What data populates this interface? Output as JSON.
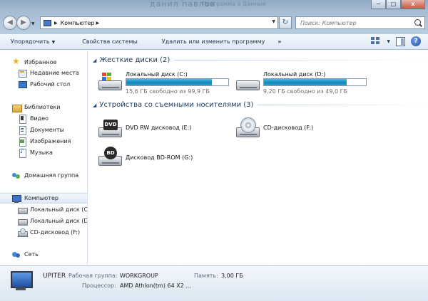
{
  "background": {
    "blur_title": "данил павлов",
    "blur_sub": "Программа в Данные"
  },
  "window": {
    "min": "─",
    "max": "□",
    "close": "x"
  },
  "address": {
    "crumb": "Компьютер",
    "search_placeholder": "Поиск: Компьютер"
  },
  "toolbar": {
    "organize": "Упорядочить",
    "properties": "Свойства системы",
    "uninstall": "Удалить или изменить программу",
    "more": "»",
    "help": "?"
  },
  "sidebar": {
    "favorites": "Избранное",
    "recent": "Недавние места",
    "desktop": "Рабочий стол",
    "libraries": "Библиотеки",
    "video": "Видео",
    "documents": "Документы",
    "images": "Изображения",
    "music": "Музыка",
    "homegroup": "Домашняя группа",
    "computer": "Компьютер",
    "disk_c": "Локальный диск (C",
    "disk_d": "Локальный диск (D",
    "cd_f": "CD-дисковод (F:)",
    "network": "Сеть"
  },
  "sections": {
    "hdd": "Жесткие диски (2)",
    "removable": "Устройства со съемными носителями (3)"
  },
  "drives": {
    "c": {
      "name": "Локальный диск (C:)",
      "free": "15,6 ГБ свободно из 99,9 ГБ",
      "used_fraction": 0.84
    },
    "d": {
      "name": "Локальный диск (D:)",
      "free": "9,20 ГБ свободно из 49,0 ГБ",
      "used_fraction": 0.81
    },
    "e": {
      "name": "DVD RW дисковод (E:)",
      "badge": "DVD"
    },
    "f": {
      "name": "CD-дисковод (F:)"
    },
    "g": {
      "name": "Дисковод BD-ROM (G:)",
      "badge": "BD"
    }
  },
  "details": {
    "computer_name": "UPITER",
    "workgroup_label": "Рабочая группа:",
    "workgroup": "WORKGROUP",
    "memory_label": "Память:",
    "memory": "3,00 ГБ",
    "cpu_label": "Процессор:",
    "cpu": "AMD Athlon(tm) 64 X2 ..."
  },
  "colors": {
    "bar_fill": "#1786b8",
    "selection": "#dfeaf7",
    "header_text": "#1e395b"
  }
}
